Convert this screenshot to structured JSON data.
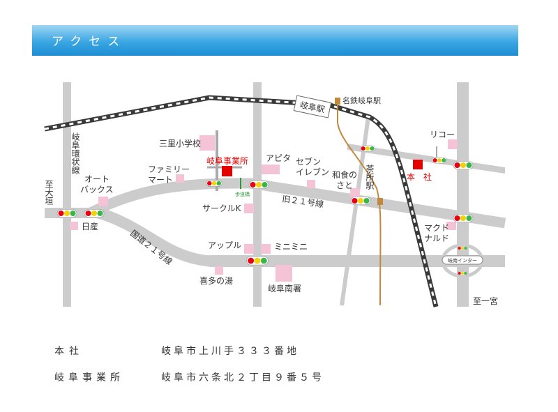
{
  "header": {
    "title": "アクセス"
  },
  "map": {
    "labels": {
      "gifu_station": "岐阜駅",
      "meitetsu_gifu_station": "名鉄岐阜駅",
      "gifu_ring_road": "岐阜環状線",
      "to_ogaki": "至大垣",
      "autobacs": "オートバックス",
      "nissan": "日産",
      "family_mart": "ファミリーマート",
      "misato_school": "三里小学校",
      "gifu_office": "岐阜事業所",
      "footbridge": "歩道橋",
      "circle_k": "サークルK",
      "apita": "アピタ",
      "seven_eleven": "セブンイレブン",
      "washoku_sato": "和食のさと",
      "chasho_station": "茶所駅",
      "old_route21": "旧２１号線",
      "ricoh": "リコー",
      "head_office": "本　社",
      "mcdonalds": "マクドナルド",
      "national_route21": "国道２１号線",
      "apple": "アップル",
      "mini_mini": "ミニミニ",
      "kitano_yu": "喜多の湯",
      "gifu_south_police": "岐阜南署",
      "gifu_minami_ic": "岐南インター",
      "to_ichinomiya": "至一宮"
    },
    "colors": {
      "road": "#cccccc",
      "rail": "#3a3a3a",
      "meitetsu_line": "#c0893e",
      "landmark": "#f5c3d6",
      "office": "#e40000",
      "signal_red": "#e60012",
      "signal_yellow": "#f4d20a",
      "signal_green": "#3ab54a",
      "footbridge": "#2e9a3c"
    }
  },
  "address": {
    "head_office_label": "本社",
    "head_office_value": "岐阜市上川手３３３番地",
    "gifu_office_label": "岐阜事業所",
    "gifu_office_value": "岐阜市六条北２丁目９番５号"
  }
}
